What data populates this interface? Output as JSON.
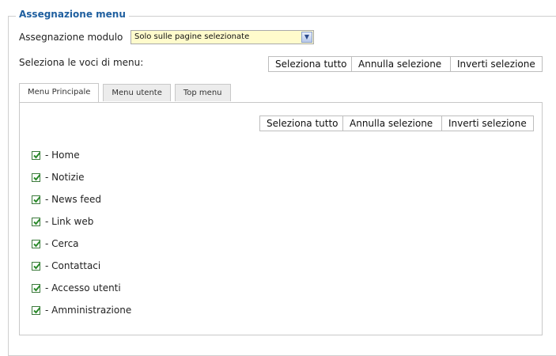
{
  "section": {
    "title": "Assegnazione menu"
  },
  "module": {
    "label": "Assegnazione modulo",
    "selected": "Solo sulle pagine selezionate"
  },
  "select_items": {
    "label": "Seleziona le voci di menu:",
    "buttons": {
      "select_all": "Seleziona tutto",
      "deselect": "Annulla selezione",
      "invert": "Inverti selezione"
    }
  },
  "tabs": [
    {
      "label": "Menu Principale",
      "active": true
    },
    {
      "label": "Menu utente",
      "active": false
    },
    {
      "label": "Top menu",
      "active": false
    }
  ],
  "panel": {
    "buttons": {
      "select_all": "Seleziona tutto",
      "deselect": "Annulla selezione",
      "invert": "Inverti selezione"
    },
    "items": [
      {
        "label": "- Home",
        "checked": true
      },
      {
        "label": "- Notizie",
        "checked": true
      },
      {
        "label": "- News feed",
        "checked": true
      },
      {
        "label": "- Link web",
        "checked": true
      },
      {
        "label": "- Cerca",
        "checked": true
      },
      {
        "label": "- Contattaci",
        "checked": true
      },
      {
        "label": "- Accesso utenti",
        "checked": true
      },
      {
        "label": "- Amministrazione",
        "checked": true
      }
    ]
  },
  "colors": {
    "legend": "#1f5f9f",
    "select_bg": "#fffbcc",
    "check": "#2a8a2a"
  }
}
